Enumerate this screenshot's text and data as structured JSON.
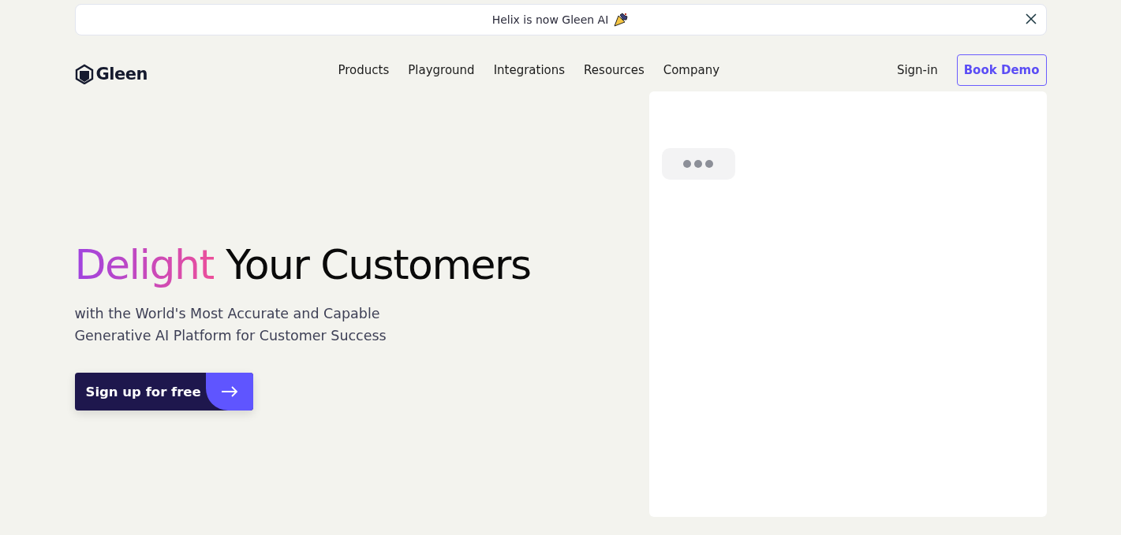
{
  "banner": {
    "text": "Helix is now Gleen AI"
  },
  "nav": {
    "logo": "Gleen",
    "links": [
      "Products",
      "Playground",
      "Integrations",
      "Resources",
      "Company"
    ],
    "sign_in": "Sign-in",
    "cta": "Book Demo"
  },
  "hero": {
    "headline_accent": "Delight",
    "headline_rest": "Your Customers",
    "subtitle_lines": [
      "with the World's Most Accurate and Capable",
      "Generative AI Platform for Customer Success"
    ],
    "button": "Sign up for free"
  }
}
